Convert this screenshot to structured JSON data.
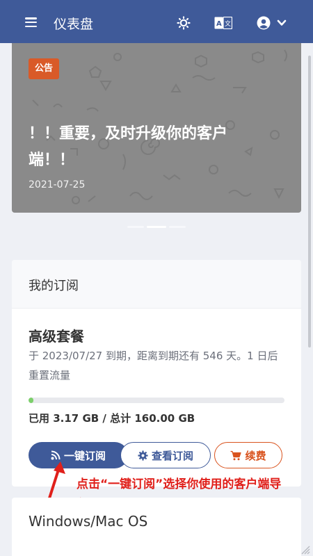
{
  "header": {
    "title": "仪表盘",
    "icons": [
      "menu-icon",
      "theme-icon",
      "language-icon",
      "user-icon",
      "chevron-down-icon"
    ],
    "language_icon_text": "A 文"
  },
  "announcement": {
    "badge": "公告",
    "title": "！！重要，及时升级你的客户端！！",
    "date": "2021-07-25"
  },
  "subscription": {
    "header": "我的订阅",
    "plan_name": "高级套餐",
    "description": "于 2023/07/27 到期，距离到期还有 546 天。1 日后重置流量",
    "usage_text": "已用 3.17 GB / 总计 160.00 GB",
    "usage_fraction": 0.02,
    "buttons": {
      "one_click": "一键订阅",
      "view": "查看订阅",
      "renew": "续费"
    }
  },
  "annotation": "点击“一键订阅”选择你使用的客户端导入",
  "platform_card": {
    "title": "Windows/Mac OS"
  },
  "colors": {
    "brand": "#3f5a99",
    "badge": "#d95a28",
    "renew": "#d9531e",
    "annotation": "#e0201b",
    "progress": "#7ccf6b"
  }
}
